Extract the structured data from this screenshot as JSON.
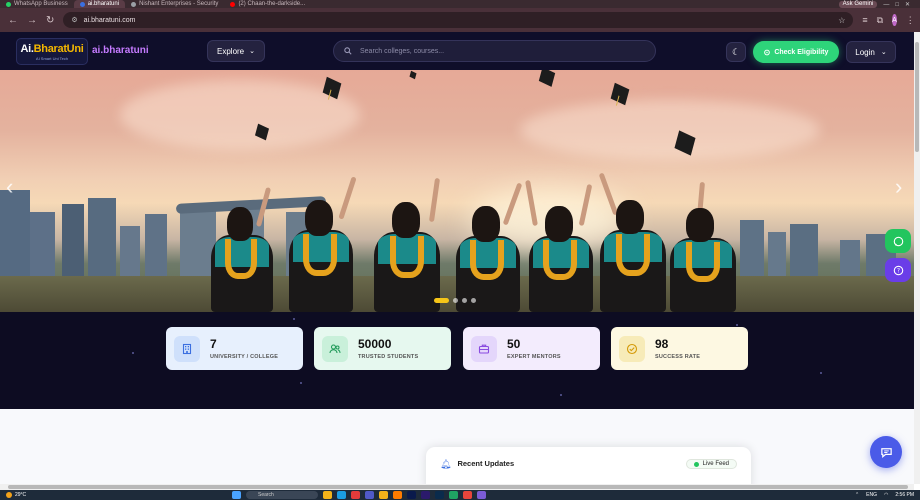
{
  "browser": {
    "tabs": [
      {
        "title": "WhatsApp Business",
        "color": "#25d366",
        "active": false
      },
      {
        "title": "ai.bharatuni",
        "color": "#3b6fe0",
        "active": true
      },
      {
        "title": "Nishant Enterprises - Security",
        "color": "#9aa0a6",
        "active": false
      },
      {
        "title": "(2) Chaan-the-darkside...",
        "color": "#ff0000",
        "active": false
      }
    ],
    "ask_gemini": "Ask Gemini",
    "url": "ai.bharatuni.com",
    "profile_initial": "A"
  },
  "header": {
    "logo_main": "Ai.",
    "logo_accent": "BharatUni",
    "logo_sub": "AI Smart Uni Tech",
    "brand": "ai.bharatuni",
    "explore_label": "Explore",
    "search_placeholder": "Search colleges, courses...",
    "eligibility_label": "Check Eligibility",
    "login_label": "Login"
  },
  "hero": {
    "active_slide": 1,
    "slide_count": 4
  },
  "stats": [
    {
      "value": "7",
      "label": "UNIVERSITY / COLLEGE",
      "icon": "building-icon",
      "bg": "#e7f0fd",
      "icon_bg": "#cfe0fb",
      "icon_color": "#3b6fe0"
    },
    {
      "value": "50000",
      "label": "TRUSTED STUDENTS",
      "icon": "users-icon",
      "bg": "#e6f8ef",
      "icon_bg": "#c9f0da",
      "icon_color": "#1f9a58"
    },
    {
      "value": "50",
      "label": "EXPERT MENTORS",
      "icon": "briefcase-icon",
      "bg": "#f3ecfd",
      "icon_bg": "#e4d6fb",
      "icon_color": "#8a4be0"
    },
    {
      "value": "98",
      "label": "SUCCESS RATE",
      "icon": "check-circle-icon",
      "bg": "#fdf8e2",
      "icon_bg": "#f7ebb8",
      "icon_color": "#d49a08"
    }
  ],
  "updates": {
    "title": "Recent Updates",
    "live_label": "Live Feed"
  },
  "taskbar": {
    "temperature": "29°C",
    "search_label": "Search",
    "language": "ENG",
    "time": "2:56 PM"
  }
}
